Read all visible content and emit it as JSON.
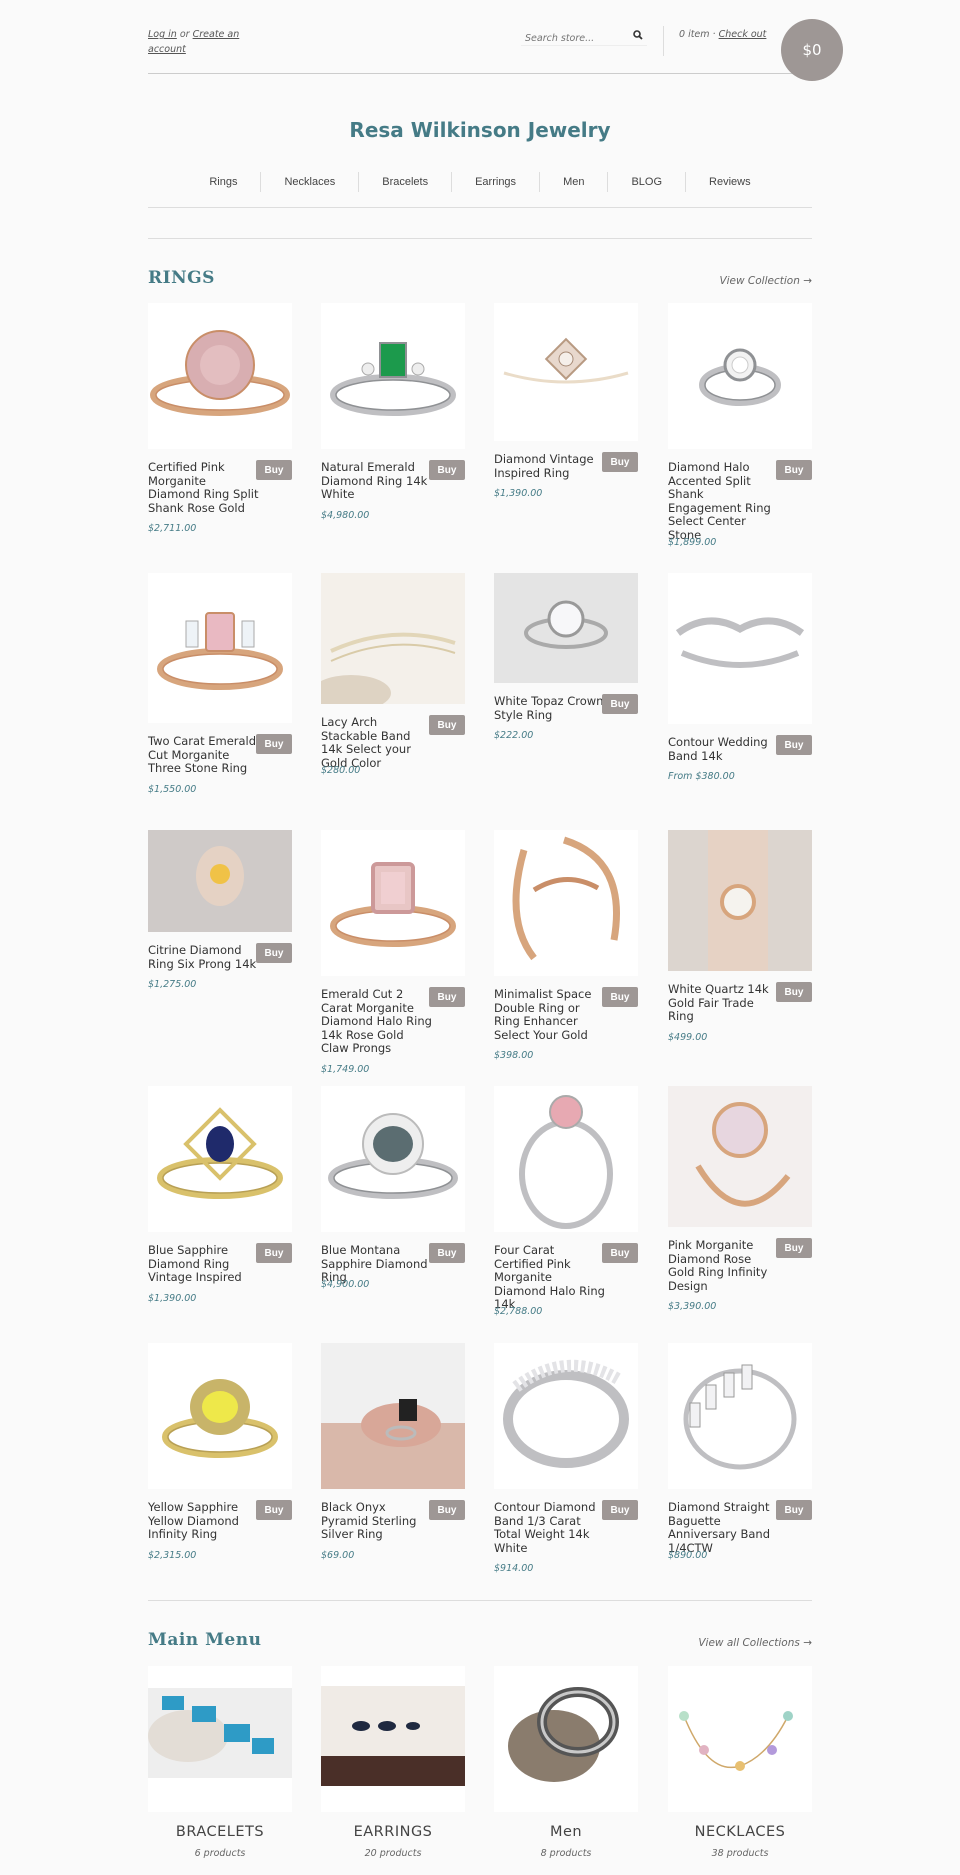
{
  "header": {
    "login_label": "Log in",
    "or_text": "or",
    "create_label": "Create an account",
    "search_placeholder": "Search store...",
    "cart_items": "0 item",
    "checkout_label": "Check out",
    "cart_total": "$0"
  },
  "brand": "Resa Wilkinson Jewelry",
  "nav": [
    "Rings",
    "Necklaces",
    "Bracelets",
    "Earrings",
    "Men",
    "BLOG",
    "Reviews"
  ],
  "rings": {
    "title": "RINGS",
    "view_link": "View Collection →",
    "buy_label": "Buy",
    "products": [
      {
        "name": "Certified Pink Morganite Diamond Ring Split Shank Rose Gold",
        "price": "$2,711.00"
      },
      {
        "name": "Natural Emerald Diamond Ring 14k White",
        "price": "$4,980.00"
      },
      {
        "name": "Diamond Vintage Inspired Ring",
        "price": "$1,390.00"
      },
      {
        "name": "Diamond Halo Accented Split Shank Engagement Ring Select Center Stone",
        "price": "$1,899.00"
      },
      {
        "name": "Two Carat Emerald Cut Morganite Three Stone Ring",
        "price": "$1,550.00"
      },
      {
        "name": "Lacy Arch Stackable Band 14k Select your Gold Color",
        "price": "$280.00"
      },
      {
        "name": "White Topaz Crown Style Ring",
        "price": "$222.00"
      },
      {
        "name": "Contour Wedding Band 14k",
        "price": "From $380.00"
      },
      {
        "name": "Citrine Diamond Ring Six Prong 14k",
        "price": "$1,275.00"
      },
      {
        "name": "Emerald Cut 2 Carat Morganite Diamond Halo Ring 14k Rose Gold Claw Prongs",
        "price": "$1,749.00"
      },
      {
        "name": "Minimalist Space Double Ring or Ring Enhancer Select Your Gold",
        "price": "$398.00"
      },
      {
        "name": "White Quartz 14k Gold Fair Trade Ring",
        "price": "$499.00"
      },
      {
        "name": "Blue Sapphire Diamond Ring Vintage Inspired",
        "price": "$1,390.00"
      },
      {
        "name": "Blue Montana Sapphire Diamond Ring",
        "price": "$4,900.00"
      },
      {
        "name": "Four Carat Certified Pink Morganite Diamond Halo Ring 14k",
        "price": "$2,788.00"
      },
      {
        "name": "Pink Morganite Diamond Rose Gold Ring Infinity Design",
        "price": "$3,390.00"
      },
      {
        "name": "Yellow Sapphire Yellow Diamond Infinity Ring",
        "price": "$2,315.00"
      },
      {
        "name": "Black Onyx Pyramid Sterling Silver Ring",
        "price": "$69.00"
      },
      {
        "name": "Contour Diamond Band 1/3 Carat Total Weight 14k White",
        "price": "$914.00"
      },
      {
        "name": "Diamond Straight Baguette Anniversary Band 1/4CTW",
        "price": "$890.00"
      }
    ]
  },
  "main_menu": {
    "title": "Main Menu",
    "view_link": "View all Collections →",
    "collections": [
      {
        "name": "BRACELETS",
        "count": "6 products"
      },
      {
        "name": "EARRINGS",
        "count": "20 products"
      },
      {
        "name": "Men",
        "count": "8 products"
      },
      {
        "name": "NECKLACES",
        "count": "38 products"
      }
    ]
  }
}
